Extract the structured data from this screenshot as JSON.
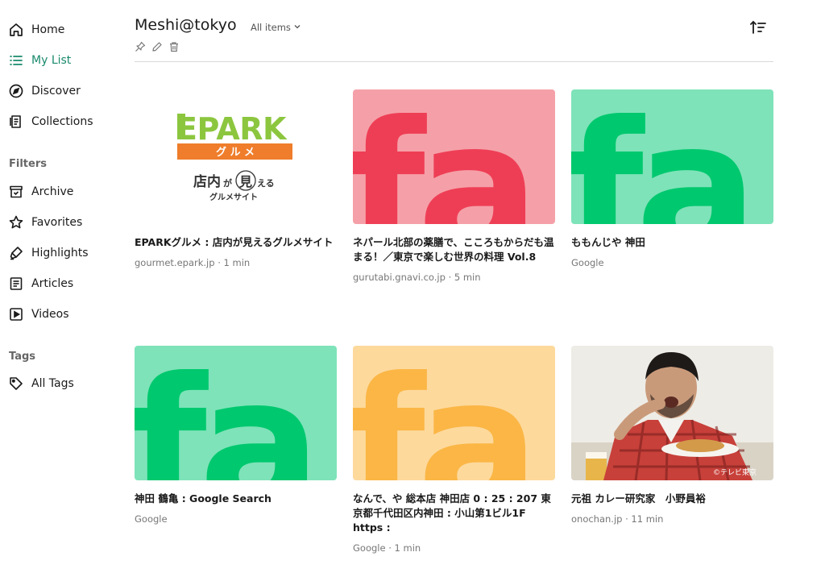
{
  "sidebar": {
    "nav": [
      {
        "label": "Home",
        "icon": "home-icon"
      },
      {
        "label": "My List",
        "icon": "list-icon"
      },
      {
        "label": "Discover",
        "icon": "compass-icon"
      },
      {
        "label": "Collections",
        "icon": "collections-icon"
      }
    ],
    "filters_label": "Filters",
    "filters": [
      {
        "label": "Archive",
        "icon": "archive-icon"
      },
      {
        "label": "Favorites",
        "icon": "star-icon"
      },
      {
        "label": "Highlights",
        "icon": "highlighter-icon"
      },
      {
        "label": "Articles",
        "icon": "article-icon"
      },
      {
        "label": "Videos",
        "icon": "video-icon"
      }
    ],
    "tags_label": "Tags",
    "tags": [
      {
        "label": "All Tags",
        "icon": "tag-icon"
      }
    ]
  },
  "header": {
    "title": "Meshi@tokyo",
    "filter_label": "All items"
  },
  "colors": {
    "pink_bg": "#f5a0a8",
    "pink_fg": "#ee3e55",
    "green_bg": "#7ee3b9",
    "green_fg": "#00c86e",
    "orange_bg": "#fdd99c",
    "orange_fg": "#fbb645",
    "epark_orange": "#ef7d2b",
    "epark_green": "#8cc63f"
  },
  "epark_logo": {
    "brand": "EPARK",
    "band": "グ ル メ",
    "tagline_1": "店内",
    "tagline_ga": "が",
    "tagline_mi": "見",
    "tagline_eru": "える",
    "tagline_2": "グルメサイト"
  },
  "cards": [
    {
      "title": "EPARKグルメ : 店内が見えるグルメサイト",
      "meta": "gourmet.epark.jp · 1 min"
    },
    {
      "title": "ネパール北部の薬膳で、こころもからだも温まる！／東京で楽しむ世界の料理 Vol.8",
      "meta": "gurutabi.gnavi.co.jp · 5 min",
      "thumb_letters": "fa"
    },
    {
      "title": "ももんじや 神田",
      "meta": "Google",
      "thumb_letters": "fa"
    },
    {
      "title": "神田 鶴亀 : Google Search",
      "meta": "Google",
      "thumb_letters": "fa"
    },
    {
      "title": "なんで、や 総本店 神田店 0 : 25 : 207 東京都千代田区内神田 : 小山第1ビル1F https :",
      "meta": "Google · 1 min",
      "thumb_letters": "fa"
    },
    {
      "title": "元祖 カレー研究家　小野員裕",
      "meta": "onochan.jp · 11 min",
      "photo_credit": "©テレビ東京"
    }
  ]
}
